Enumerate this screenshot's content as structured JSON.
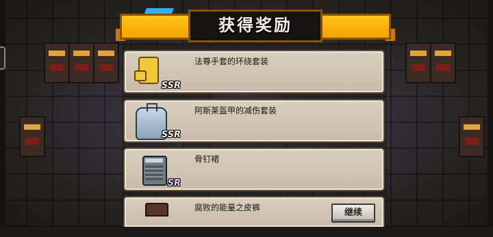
{
  "title": "获得奖励",
  "items": [
    {
      "name": "法尊手套的环绕套装",
      "rarity": "SSR",
      "icon": "golden-glove-icon",
      "rarity_color": "#f1ede8"
    },
    {
      "name": "阿斯莱盔甲的减伤套装",
      "rarity": "SSR",
      "icon": "silver-armor-icon",
      "rarity_color": "#f1ede8"
    },
    {
      "name": "骨钉裙",
      "rarity": "SR",
      "icon": "bone-skirt-icon",
      "rarity_color": "#e3c6ff"
    },
    {
      "name": "腐败的能量之皮裤",
      "rarity": "",
      "icon": "leather-pants-icon",
      "rarity_color": ""
    }
  ],
  "continue_label": "继续",
  "colors": {
    "banner": "#ffc21a",
    "card": "#d9cfc0",
    "accent_blue": "#2ab3ff"
  }
}
